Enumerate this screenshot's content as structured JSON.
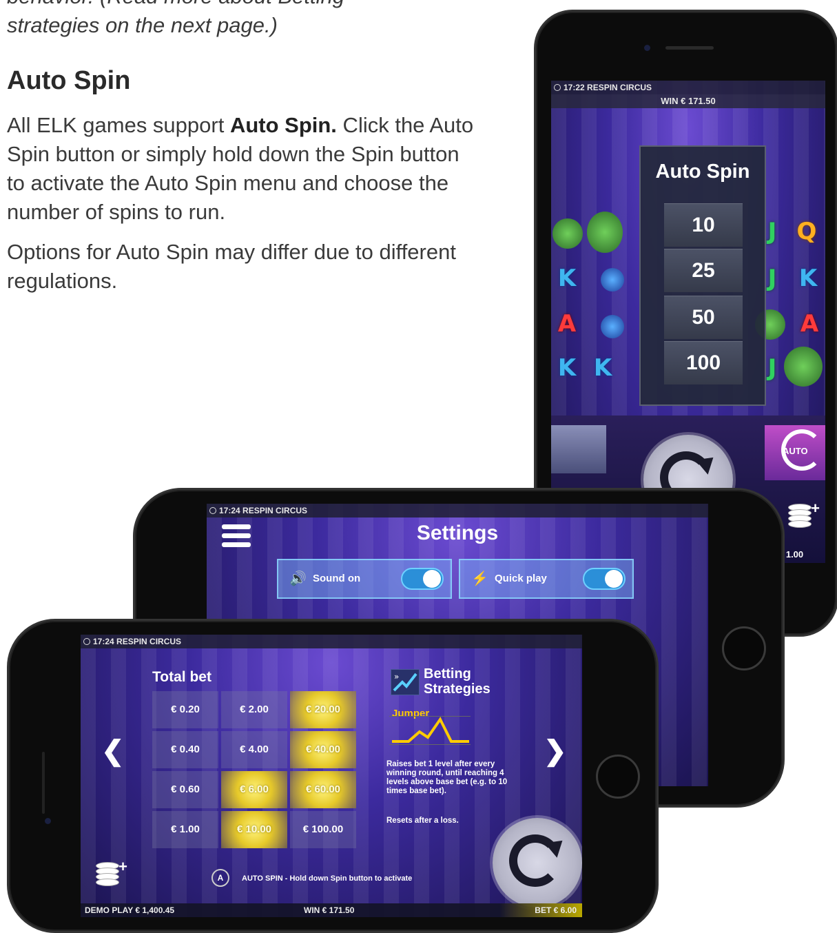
{
  "doc": {
    "intro_line1": "behavior. (Read more about Betting",
    "intro_line2": "strategies on the next page.)",
    "heading": "Auto Spin",
    "para1_start": "All ELK games support ",
    "para1_bold": "Auto Spin.",
    "para1_end": " Click the Auto Spin button or simply hold down the Spin button to activate the Auto Spin menu and choose the number of spins to run.",
    "para2": "Options for Auto Spin may differ due to different regulations."
  },
  "portrait": {
    "topbar": "17:22 RESPIN CIRCUS",
    "win": "WIN € 171.50",
    "auto_title": "Auto Spin",
    "options": [
      "10",
      "25",
      "50",
      "100"
    ],
    "auto_label": "AUTO",
    "bet_fragment": "€ 1.00"
  },
  "settings": {
    "topbar": "17:24 RESPIN CIRCUS",
    "title": "Settings",
    "sound_label": "Sound on",
    "quick_label": "Quick play"
  },
  "bet_screen": {
    "topbar": "17:24 RESPIN CIRCUS",
    "title": "Total bet",
    "cells": [
      [
        "€ 0.20",
        "€ 2.00",
        "€ 20.00"
      ],
      [
        "€ 0.40",
        "€ 4.00",
        "€ 40.00"
      ],
      [
        "€ 0.60",
        "€ 6.00",
        "€ 60.00"
      ],
      [
        "€ 1.00",
        "€ 10.00",
        "€ 100.00"
      ]
    ],
    "bs_title_1": "Betting",
    "bs_title_2": "Strategies",
    "bs_name": "Jumper",
    "bs_desc": "Raises bet 1 level after every winning round, until reaching 4 levels above base bet (e.g. to 10 times base bet).",
    "bs_reset": "Resets after a loss.",
    "autospin_hint": "AUTO SPIN - Hold down Spin button to activate",
    "autospin_icon": "A",
    "demo": "DEMO PLAY € 1,400.45",
    "win": "WIN € 171.50",
    "bet": "BET € 6.00"
  },
  "icons": {
    "clock": "clock-icon",
    "menu": "hamburger-menu-icon",
    "sound": "speaker-icon",
    "quick": "lightning-icon",
    "spin": "spin-arrow-icon",
    "coins": "coin-stack-plus-icon"
  },
  "colors": {
    "highlight": "#e6c92a",
    "toggle": "#2b8fd8",
    "jumper": "#ffcc00"
  }
}
